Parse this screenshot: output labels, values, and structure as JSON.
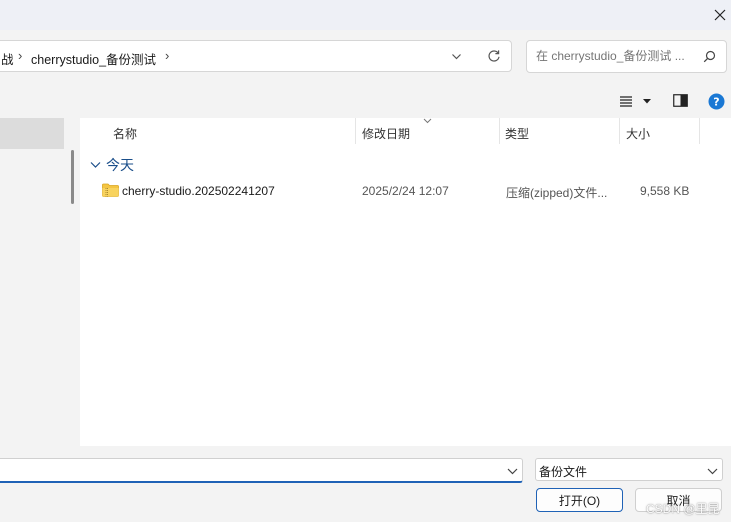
{
  "breadcrumb": {
    "partial": "战",
    "folder": "cherrystudio_备份测试"
  },
  "search": {
    "placeholder": "在 cherrystudio_备份测试 ..."
  },
  "columns": {
    "name": "名称",
    "date": "修改日期",
    "type": "类型",
    "size": "大小"
  },
  "group": {
    "label": "今天"
  },
  "files": [
    {
      "name": "cherry-studio.202502241207",
      "date": "2025/2/24 12:07",
      "type": "压缩(zipped)文件...",
      "size": "9,558 KB"
    }
  ],
  "filename": {
    "value": ""
  },
  "filetype": {
    "selected": "备份文件"
  },
  "buttons": {
    "open": "打开(O)",
    "cancel": "取消"
  },
  "watermark": "CSDN @里昆",
  "icons": {
    "close": "close-icon",
    "dropdown": "chevron-down-icon",
    "refresh": "refresh-icon",
    "search": "search-icon",
    "view_menu": "view-menu-icon",
    "preview_pane": "preview-pane-icon",
    "help": "help-icon",
    "zip_folder": "zip-folder-icon"
  },
  "colors": {
    "accent": "#1f62b6",
    "help": "#1a78d4",
    "group_header": "#1a4e8a"
  }
}
